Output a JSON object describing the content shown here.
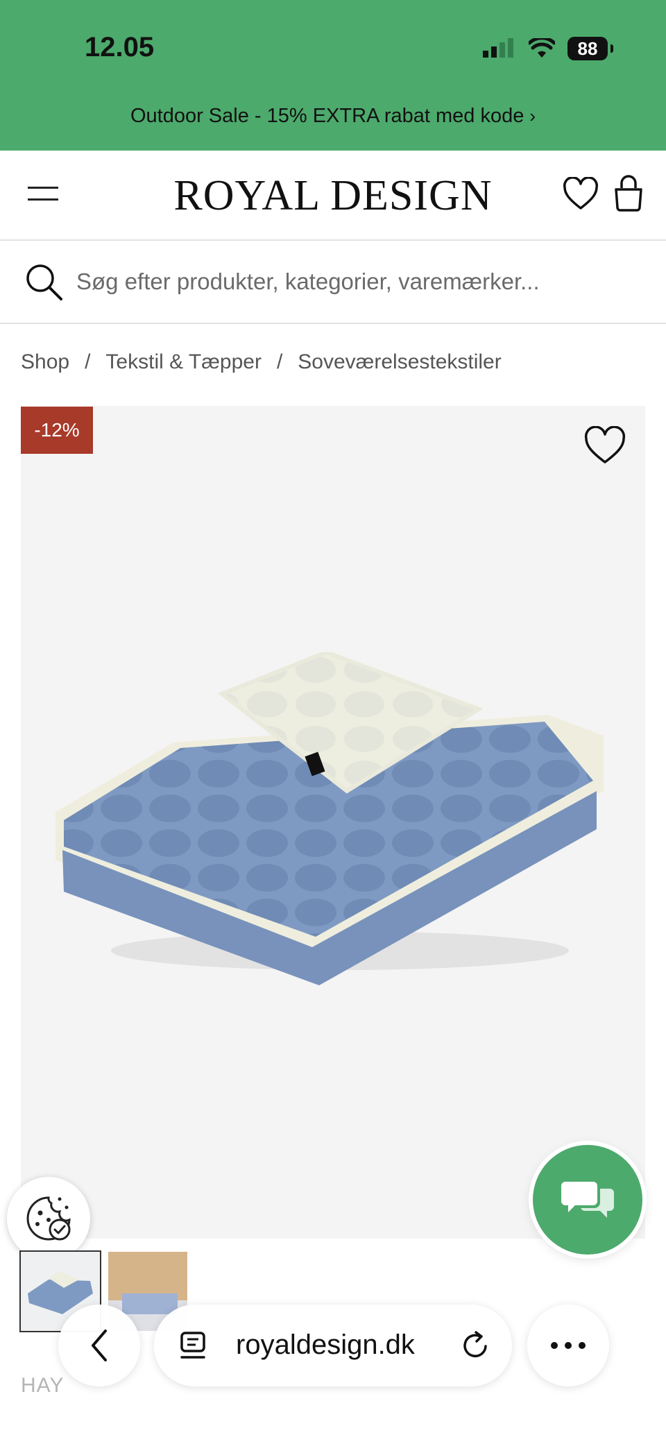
{
  "status_bar": {
    "time": "12.05",
    "battery": "88",
    "icons": [
      "signal-icon",
      "wifi-icon",
      "battery-icon"
    ]
  },
  "promo": {
    "text": "Outdoor Sale - 15% EXTRA rabat med kode",
    "chevron": "›"
  },
  "header": {
    "logo": "ROYAL DESIGN",
    "icons": [
      "menu-icon",
      "heart-icon",
      "bag-icon"
    ]
  },
  "search": {
    "placeholder": "Søg efter produkter, kategorier, varemærker..."
  },
  "breadcrumb": {
    "items": [
      "Shop",
      "Tekstil & Tæpper",
      "Soveværelsestekstiler"
    ],
    "separator": "/"
  },
  "product": {
    "discount_badge": "-12%",
    "brand": "HAY",
    "tag_text": "HAY"
  },
  "browser": {
    "url": "royaldesign.dk"
  },
  "colors": {
    "brand_green": "#4caa6c",
    "badge_red": "#a83a2a",
    "image_bg": "#f4f4f4"
  }
}
